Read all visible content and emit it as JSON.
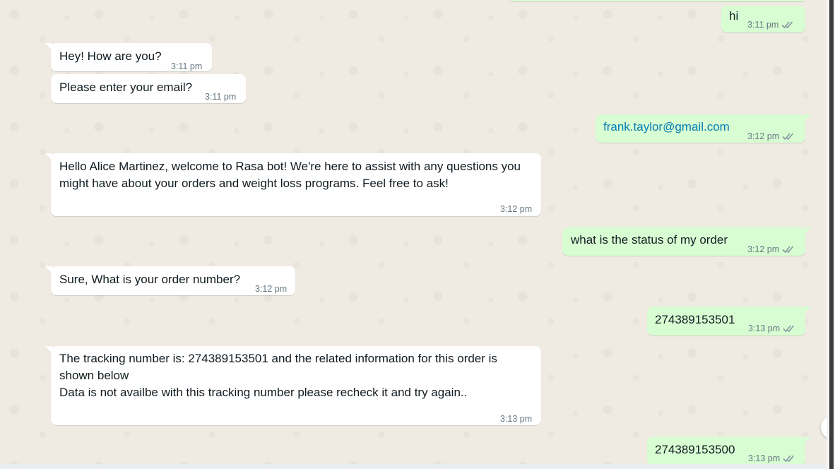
{
  "chat": {
    "messages": [
      {
        "id": "m1",
        "direction": "out",
        "text": "hi",
        "time": "3:11 pm"
      },
      {
        "id": "m2",
        "direction": "in",
        "text": "Hey! How are you?",
        "time": "3:11 pm"
      },
      {
        "id": "m3",
        "direction": "in",
        "text": "Please enter your email?",
        "time": "3:11 pm"
      },
      {
        "id": "m4",
        "direction": "out",
        "text": "frank.taylor@gmail.com",
        "time": "3:12 pm",
        "is_link": true
      },
      {
        "id": "m5",
        "direction": "in",
        "text": "Hello Alice Martinez, welcome to Rasa bot! We're here to assist with any questions you might have about your orders and weight loss programs. Feel free to ask!",
        "time": "3:12 pm"
      },
      {
        "id": "m6",
        "direction": "out",
        "text": "what is the status of my order",
        "time": "3:12 pm"
      },
      {
        "id": "m7",
        "direction": "in",
        "text": "Sure, What is your order number?",
        "time": "3:12 pm"
      },
      {
        "id": "m8",
        "direction": "out",
        "text": "274389153501",
        "time": "3:13 pm"
      },
      {
        "id": "m9",
        "direction": "in",
        "text": "The tracking number is: 274389153501 and the related information for this order is shown below\nData is not availbe with this tracking number please recheck it and try again..",
        "time": "3:13 pm"
      },
      {
        "id": "m10",
        "direction": "out",
        "text": "274389153500",
        "time": "3:13 pm"
      }
    ]
  },
  "colors": {
    "background": "#efeae2",
    "incoming_bubble": "#ffffff",
    "outgoing_bubble": "#d9fdd3",
    "timestamp": "#667781",
    "read_ticks": "#8696a0",
    "link": "#027eb5"
  },
  "icons": {
    "read_receipt": "double-check-icon",
    "scroll_down": "chevron-down-icon"
  }
}
